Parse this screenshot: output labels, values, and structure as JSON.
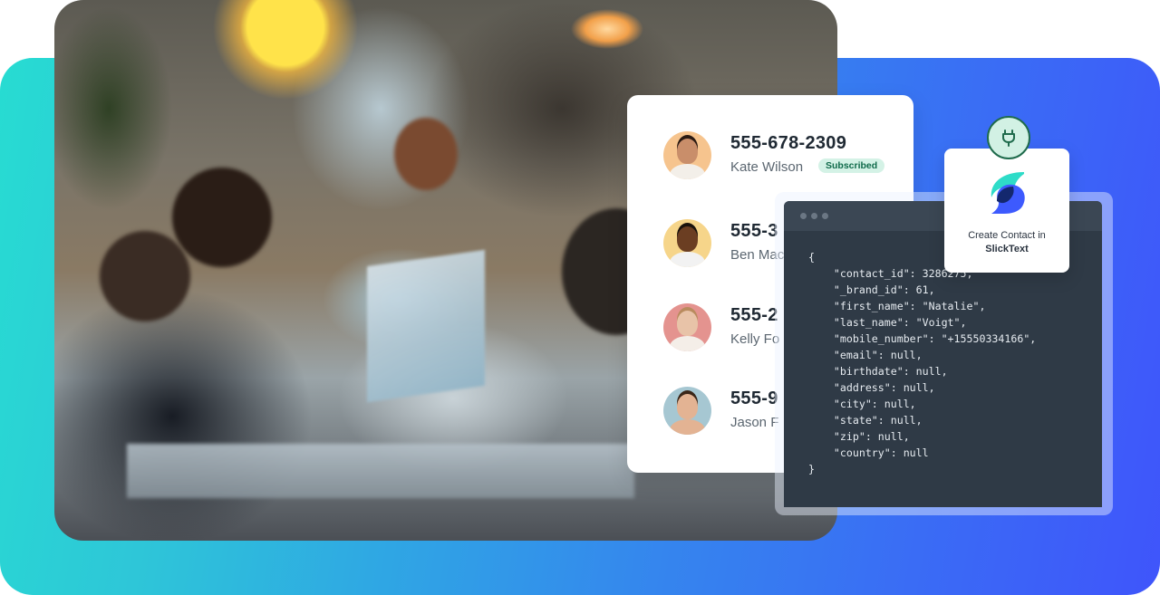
{
  "contacts_card": {
    "items": [
      {
        "phone": "555-678-2309",
        "name": "Kate Wilson",
        "badge": "Subscribed",
        "avatar_bg": "#f6c48e",
        "skin": "#c98e6a",
        "hair": "#2a1a12",
        "shirt": "#f3efe9"
      },
      {
        "phone": "555-3",
        "name": "Ben Mac",
        "badge": null,
        "avatar_bg": "#f6d58a",
        "skin": "#6b3e22",
        "hair": "#1a120c",
        "shirt": "#f2f2f2"
      },
      {
        "phone": "555-2",
        "name": "Kelly Fo",
        "badge": null,
        "avatar_bg": "#e4938f",
        "skin": "#e8c3a8",
        "hair": "#b98b5e",
        "shirt": "#f4eee8"
      },
      {
        "phone": "555-9",
        "name": "Jason F",
        "badge": null,
        "avatar_bg": "#a6c7d2",
        "skin": "#e3b393",
        "hair": "#3a2618",
        "shirt": "#e3b393"
      }
    ]
  },
  "code_window": {
    "titlebar_dots": 3,
    "lines": [
      "{",
      "    \"contact_id\": 3286275,",
      "    \"_brand_id\": 61,",
      "    \"first_name\": \"Natalie\",",
      "    \"last_name\": \"Voigt\",",
      "    \"mobile_number\": \"+15550334166\",",
      "    \"email\": null,",
      "    \"birthdate\": null,",
      "    \"address\": null,",
      "    \"city\": null,",
      "    \"state\": null,",
      "    \"zip\": null,",
      "    \"country\": null",
      "}"
    ]
  },
  "integration_card": {
    "icon": "plug-icon",
    "logo": "slicktext-logo",
    "action_label": "Create Contact in",
    "brand_label": "SlickText"
  },
  "colors": {
    "gradient_start": "#27dcd2",
    "gradient_end": "#3f55fb",
    "badge_bg": "#d4f2e6",
    "badge_text": "#0f6a4a",
    "code_bg": "#2f3a46",
    "logo_teal": "#2edcc8",
    "logo_blue": "#3d5afe",
    "logo_navy": "#14286e"
  }
}
